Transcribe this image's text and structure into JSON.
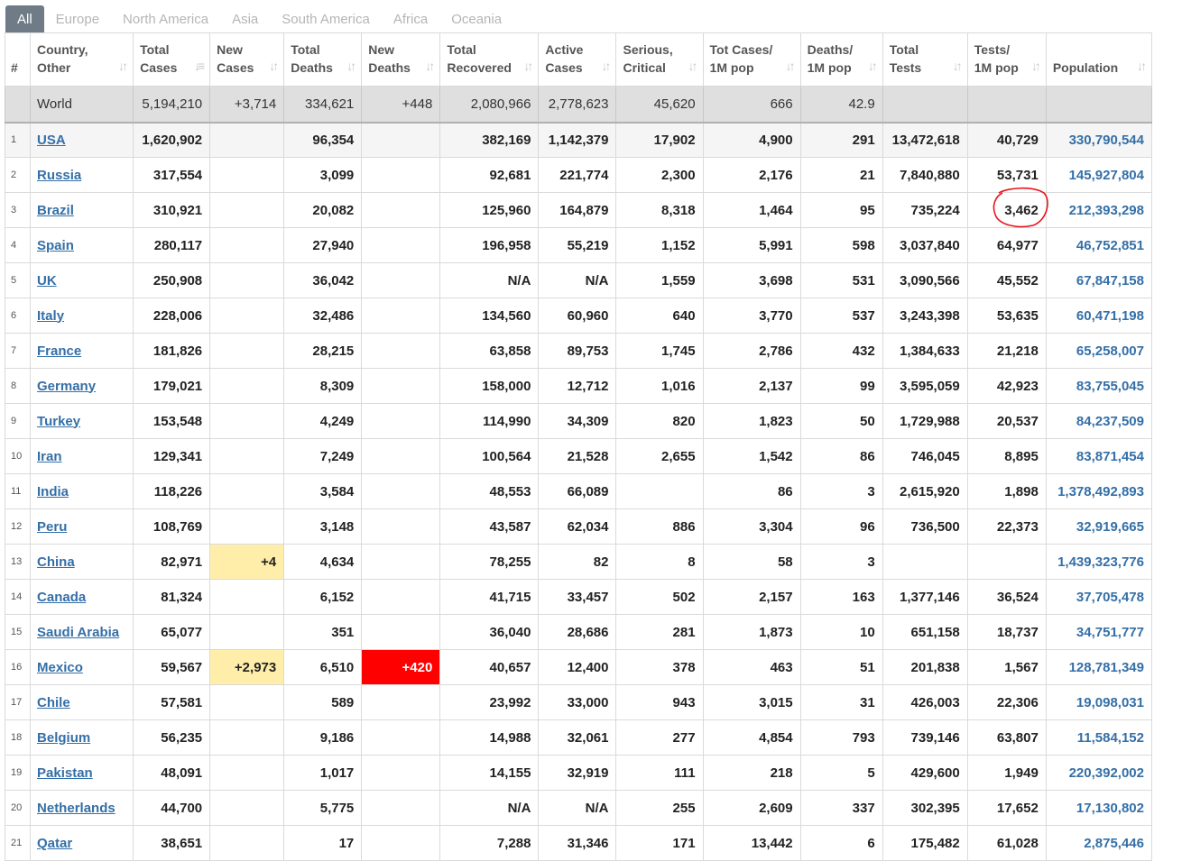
{
  "tabs": [
    "All",
    "Europe",
    "North America",
    "Asia",
    "South America",
    "Africa",
    "Oceania"
  ],
  "active_tab": "All",
  "headers": [
    {
      "l1": "#",
      "l2": ""
    },
    {
      "l1": "Country,",
      "l2": "Other"
    },
    {
      "l1": "Total",
      "l2": "Cases"
    },
    {
      "l1": "New",
      "l2": "Cases"
    },
    {
      "l1": "Total",
      "l2": "Deaths"
    },
    {
      "l1": "New",
      "l2": "Deaths"
    },
    {
      "l1": "Total",
      "l2": "Recovered"
    },
    {
      "l1": "Active",
      "l2": "Cases"
    },
    {
      "l1": "Serious,",
      "l2": "Critical"
    },
    {
      "l1": "Tot Cases/",
      "l2": "1M pop"
    },
    {
      "l1": "Deaths/",
      "l2": "1M pop"
    },
    {
      "l1": "Total",
      "l2": "Tests"
    },
    {
      "l1": "Tests/",
      "l2": "1M pop"
    },
    {
      "l1": "Population",
      "l2": ""
    }
  ],
  "world_row": {
    "country": "World",
    "total_cases": "5,194,210",
    "new_cases": "+3,714",
    "total_deaths": "334,621",
    "new_deaths": "+448",
    "total_recovered": "2,080,966",
    "active_cases": "2,778,623",
    "serious": "45,620",
    "cases_per_m": "666",
    "deaths_per_m": "42.9",
    "total_tests": "",
    "tests_per_m": "",
    "population": ""
  },
  "rows": [
    {
      "rank": "1",
      "country": "USA",
      "total_cases": "1,620,902",
      "new_cases": "",
      "total_deaths": "96,354",
      "new_deaths": "",
      "total_recovered": "382,169",
      "active_cases": "1,142,379",
      "serious": "17,902",
      "cases_per_m": "4,900",
      "deaths_per_m": "291",
      "total_tests": "13,472,618",
      "tests_per_m": "40,729",
      "population": "330,790,544"
    },
    {
      "rank": "2",
      "country": "Russia",
      "total_cases": "317,554",
      "new_cases": "",
      "total_deaths": "3,099",
      "new_deaths": "",
      "total_recovered": "92,681",
      "active_cases": "221,774",
      "serious": "2,300",
      "cases_per_m": "2,176",
      "deaths_per_m": "21",
      "total_tests": "7,840,880",
      "tests_per_m": "53,731",
      "population": "145,927,804"
    },
    {
      "rank": "3",
      "country": "Brazil",
      "total_cases": "310,921",
      "new_cases": "",
      "total_deaths": "20,082",
      "new_deaths": "",
      "total_recovered": "125,960",
      "active_cases": "164,879",
      "serious": "8,318",
      "cases_per_m": "1,464",
      "deaths_per_m": "95",
      "total_tests": "735,224",
      "tests_per_m": "3,462",
      "population": "212,393,298"
    },
    {
      "rank": "4",
      "country": "Spain",
      "total_cases": "280,117",
      "new_cases": "",
      "total_deaths": "27,940",
      "new_deaths": "",
      "total_recovered": "196,958",
      "active_cases": "55,219",
      "serious": "1,152",
      "cases_per_m": "5,991",
      "deaths_per_m": "598",
      "total_tests": "3,037,840",
      "tests_per_m": "64,977",
      "population": "46,752,851"
    },
    {
      "rank": "5",
      "country": "UK",
      "total_cases": "250,908",
      "new_cases": "",
      "total_deaths": "36,042",
      "new_deaths": "",
      "total_recovered": "N/A",
      "active_cases": "N/A",
      "serious": "1,559",
      "cases_per_m": "3,698",
      "deaths_per_m": "531",
      "total_tests": "3,090,566",
      "tests_per_m": "45,552",
      "population": "67,847,158"
    },
    {
      "rank": "6",
      "country": "Italy",
      "total_cases": "228,006",
      "new_cases": "",
      "total_deaths": "32,486",
      "new_deaths": "",
      "total_recovered": "134,560",
      "active_cases": "60,960",
      "serious": "640",
      "cases_per_m": "3,770",
      "deaths_per_m": "537",
      "total_tests": "3,243,398",
      "tests_per_m": "53,635",
      "population": "60,471,198"
    },
    {
      "rank": "7",
      "country": "France",
      "total_cases": "181,826",
      "new_cases": "",
      "total_deaths": "28,215",
      "new_deaths": "",
      "total_recovered": "63,858",
      "active_cases": "89,753",
      "serious": "1,745",
      "cases_per_m": "2,786",
      "deaths_per_m": "432",
      "total_tests": "1,384,633",
      "tests_per_m": "21,218",
      "population": "65,258,007"
    },
    {
      "rank": "8",
      "country": "Germany",
      "total_cases": "179,021",
      "new_cases": "",
      "total_deaths": "8,309",
      "new_deaths": "",
      "total_recovered": "158,000",
      "active_cases": "12,712",
      "serious": "1,016",
      "cases_per_m": "2,137",
      "deaths_per_m": "99",
      "total_tests": "3,595,059",
      "tests_per_m": "42,923",
      "population": "83,755,045"
    },
    {
      "rank": "9",
      "country": "Turkey",
      "total_cases": "153,548",
      "new_cases": "",
      "total_deaths": "4,249",
      "new_deaths": "",
      "total_recovered": "114,990",
      "active_cases": "34,309",
      "serious": "820",
      "cases_per_m": "1,823",
      "deaths_per_m": "50",
      "total_tests": "1,729,988",
      "tests_per_m": "20,537",
      "population": "84,237,509"
    },
    {
      "rank": "10",
      "country": "Iran",
      "total_cases": "129,341",
      "new_cases": "",
      "total_deaths": "7,249",
      "new_deaths": "",
      "total_recovered": "100,564",
      "active_cases": "21,528",
      "serious": "2,655",
      "cases_per_m": "1,542",
      "deaths_per_m": "86",
      "total_tests": "746,045",
      "tests_per_m": "8,895",
      "population": "83,871,454"
    },
    {
      "rank": "11",
      "country": "India",
      "total_cases": "118,226",
      "new_cases": "",
      "total_deaths": "3,584",
      "new_deaths": "",
      "total_recovered": "48,553",
      "active_cases": "66,089",
      "serious": "",
      "cases_per_m": "86",
      "deaths_per_m": "3",
      "total_tests": "2,615,920",
      "tests_per_m": "1,898",
      "population": "1,378,492,893"
    },
    {
      "rank": "12",
      "country": "Peru",
      "total_cases": "108,769",
      "new_cases": "",
      "total_deaths": "3,148",
      "new_deaths": "",
      "total_recovered": "43,587",
      "active_cases": "62,034",
      "serious": "886",
      "cases_per_m": "3,304",
      "deaths_per_m": "96",
      "total_tests": "736,500",
      "tests_per_m": "22,373",
      "population": "32,919,665"
    },
    {
      "rank": "13",
      "country": "China",
      "total_cases": "82,971",
      "new_cases": "+4",
      "total_deaths": "4,634",
      "new_deaths": "",
      "total_recovered": "78,255",
      "active_cases": "82",
      "serious": "8",
      "cases_per_m": "58",
      "deaths_per_m": "3",
      "total_tests": "",
      "tests_per_m": "",
      "population": "1,439,323,776"
    },
    {
      "rank": "14",
      "country": "Canada",
      "total_cases": "81,324",
      "new_cases": "",
      "total_deaths": "6,152",
      "new_deaths": "",
      "total_recovered": "41,715",
      "active_cases": "33,457",
      "serious": "502",
      "cases_per_m": "2,157",
      "deaths_per_m": "163",
      "total_tests": "1,377,146",
      "tests_per_m": "36,524",
      "population": "37,705,478"
    },
    {
      "rank": "15",
      "country": "Saudi Arabia",
      "total_cases": "65,077",
      "new_cases": "",
      "total_deaths": "351",
      "new_deaths": "",
      "total_recovered": "36,040",
      "active_cases": "28,686",
      "serious": "281",
      "cases_per_m": "1,873",
      "deaths_per_m": "10",
      "total_tests": "651,158",
      "tests_per_m": "18,737",
      "population": "34,751,777"
    },
    {
      "rank": "16",
      "country": "Mexico",
      "total_cases": "59,567",
      "new_cases": "+2,973",
      "total_deaths": "6,510",
      "new_deaths": "+420",
      "total_recovered": "40,657",
      "active_cases": "12,400",
      "serious": "378",
      "cases_per_m": "463",
      "deaths_per_m": "51",
      "total_tests": "201,838",
      "tests_per_m": "1,567",
      "population": "128,781,349"
    },
    {
      "rank": "17",
      "country": "Chile",
      "total_cases": "57,581",
      "new_cases": "",
      "total_deaths": "589",
      "new_deaths": "",
      "total_recovered": "23,992",
      "active_cases": "33,000",
      "serious": "943",
      "cases_per_m": "3,015",
      "deaths_per_m": "31",
      "total_tests": "426,003",
      "tests_per_m": "22,306",
      "population": "19,098,031"
    },
    {
      "rank": "18",
      "country": "Belgium",
      "total_cases": "56,235",
      "new_cases": "",
      "total_deaths": "9,186",
      "new_deaths": "",
      "total_recovered": "14,988",
      "active_cases": "32,061",
      "serious": "277",
      "cases_per_m": "4,854",
      "deaths_per_m": "793",
      "total_tests": "739,146",
      "tests_per_m": "63,807",
      "population": "11,584,152"
    },
    {
      "rank": "19",
      "country": "Pakistan",
      "total_cases": "48,091",
      "new_cases": "",
      "total_deaths": "1,017",
      "new_deaths": "",
      "total_recovered": "14,155",
      "active_cases": "32,919",
      "serious": "111",
      "cases_per_m": "218",
      "deaths_per_m": "5",
      "total_tests": "429,600",
      "tests_per_m": "1,949",
      "population": "220,392,002"
    },
    {
      "rank": "20",
      "country": "Netherlands",
      "total_cases": "44,700",
      "new_cases": "",
      "total_deaths": "5,775",
      "new_deaths": "",
      "total_recovered": "N/A",
      "active_cases": "N/A",
      "serious": "255",
      "cases_per_m": "2,609",
      "deaths_per_m": "337",
      "total_tests": "302,395",
      "tests_per_m": "17,652",
      "population": "17,130,802"
    },
    {
      "rank": "21",
      "country": "Qatar",
      "total_cases": "38,651",
      "new_cases": "",
      "total_deaths": "17",
      "new_deaths": "",
      "total_recovered": "7,288",
      "active_cases": "31,346",
      "serious": "171",
      "cases_per_m": "13,442",
      "deaths_per_m": "6",
      "total_tests": "175,482",
      "tests_per_m": "61,028",
      "population": "2,875,446"
    }
  ],
  "colors": {
    "link": "#346fa7",
    "new_cases_highlight": "#ffeeaa",
    "new_deaths_highlight": "#ff0000",
    "tab_active": "#6f7b86",
    "annotation": "#e8141c"
  },
  "icons": {
    "sort": "sort-arrows-icon",
    "sort_active": "sort-desc-icon"
  }
}
